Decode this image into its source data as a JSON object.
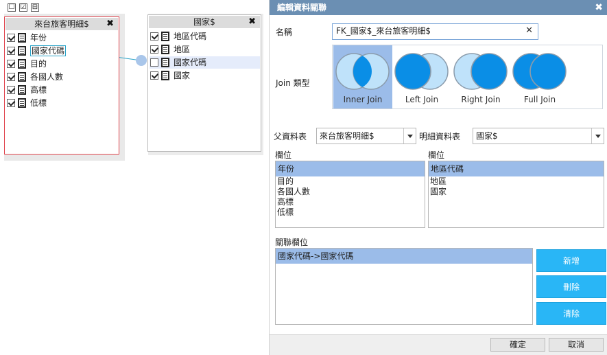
{
  "toolbar": {
    "uncheck_all": "☐",
    "check_all": "☑",
    "collapse": "⊟"
  },
  "left_table": {
    "title": "來台旅客明細$",
    "close": "✖",
    "fields": [
      {
        "label": "年份",
        "checked": true
      },
      {
        "label": "國家代碼",
        "checked": true
      },
      {
        "label": "目的",
        "checked": true
      },
      {
        "label": "各國人數",
        "checked": true
      },
      {
        "label": "高標",
        "checked": true
      },
      {
        "label": "低標",
        "checked": true
      }
    ]
  },
  "right_table": {
    "title": "國家$",
    "close": "✖",
    "fields": [
      {
        "label": "地區代碼",
        "checked": true
      },
      {
        "label": "地區",
        "checked": true
      },
      {
        "label": "國家代碼",
        "checked": false
      },
      {
        "label": "國家",
        "checked": true
      }
    ]
  },
  "dialog": {
    "title": "編輯資料關聯",
    "close": "✖",
    "name_label": "名稱",
    "name_value": "FK_國家$_來台旅客明細$",
    "name_clear": "✕",
    "join_label": "Join 類型",
    "join_types": [
      {
        "label": "Inner Join",
        "selected": true
      },
      {
        "label": "Left Join",
        "selected": false
      },
      {
        "label": "Right Join",
        "selected": false
      },
      {
        "label": "Full Join",
        "selected": false
      }
    ],
    "parent_label": "父資料表",
    "parent_value": "來台旅客明細$",
    "detail_label": "明細資料表",
    "detail_value": "國家$",
    "parent_fields_label": "欄位",
    "parent_fields": [
      "年份",
      "目的",
      "各國人數",
      "高標",
      "低標"
    ],
    "detail_fields_label": "欄位",
    "detail_fields": [
      "地區代碼",
      "地區",
      "國家"
    ],
    "relations_label": "關聯欄位",
    "relations": [
      "國家代碼->國家代碼"
    ],
    "add_button": "新增",
    "delete_button": "刪除",
    "clear_button": "清除",
    "ok_button": "確定",
    "cancel_button": "取消"
  },
  "colors": {
    "title_bar": "#6b8fb3",
    "accent_blue": "#29b6f6",
    "selection": "#9bbce9",
    "circle_fill": "#0a8ee6",
    "circle_light": "#bfe2fa",
    "active_border": "#e0434c"
  }
}
